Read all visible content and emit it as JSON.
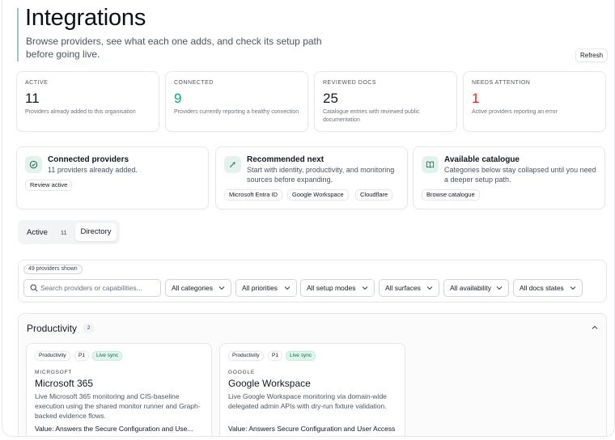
{
  "header": {
    "title": "Integrations",
    "subtitle": "Browse providers, see what each one adds, and check its setup path before going live.",
    "refresh_label": "Refresh"
  },
  "stats": [
    {
      "label": "ACTIVE",
      "value": "11",
      "desc": "Providers already added to this organisation"
    },
    {
      "label": "CONNECTED",
      "value": "9",
      "desc": "Providers currently reporting a healthy connection"
    },
    {
      "label": "REVIEWED DOCS",
      "value": "25",
      "desc": "Catalogue entries with reviewed public documentation"
    },
    {
      "label": "NEEDS ATTENTION",
      "value": "1",
      "desc": "Active providers reporting an error"
    }
  ],
  "features": {
    "connected": {
      "title": "Connected providers",
      "desc": "11 providers already added.",
      "button": "Review active",
      "icon": "check-circle-icon"
    },
    "recommended": {
      "title": "Recommended next",
      "desc_line1": "Start with identity, productivity, and monitoring",
      "desc_line2": "sources before expanding.",
      "chips": [
        "Microsoft Entra ID",
        "Google Workspace",
        "Cloudflare"
      ],
      "icon": "sparkle-icon"
    },
    "catalogue": {
      "title": "Available catalogue",
      "desc_line1": "Categories below stay collapsed until you need",
      "desc_line2": "a deeper setup path.",
      "button": "Browse catalogue",
      "icon": "book-icon"
    }
  },
  "tabs": {
    "active_label": "Active",
    "active_count": "11",
    "directory_label": "Directory"
  },
  "filters": {
    "shown": "49 providers shown",
    "search_placeholder": "Search providers or capabilities...",
    "selects": [
      "All categories",
      "All priorities",
      "All setup modes",
      "All surfaces",
      "All availability",
      "All docs states"
    ]
  },
  "section": {
    "title": "Productivity",
    "count": "2",
    "providers": [
      {
        "badges": [
          "Productivity",
          "P1",
          "Live sync"
        ],
        "vendor": "MICROSOFT",
        "name": "Microsoft 365",
        "desc": "Live Microsoft 365 monitoring and CIS-baseline execution using the shared monitor runner and Graph-backed evidence flows.",
        "value_label": "Value:",
        "value_text": "Answers the Secure Configuration and Use..."
      },
      {
        "badges": [
          "Productivity",
          "P1",
          "Live sync"
        ],
        "vendor": "GOOGLE",
        "name": "Google Workspace",
        "desc": "Live Google Workspace monitoring via domain-wide delegated admin APIs with dry-run fixture validation.",
        "value_label": "Value:",
        "value_text": "Answers Secure Configuration and User Access Control for a Google-based organisation with..."
      }
    ]
  },
  "colors": {
    "accent_green": "#16a37a",
    "error_red": "#dc2626",
    "icon_bg": "#e3f3ec"
  }
}
